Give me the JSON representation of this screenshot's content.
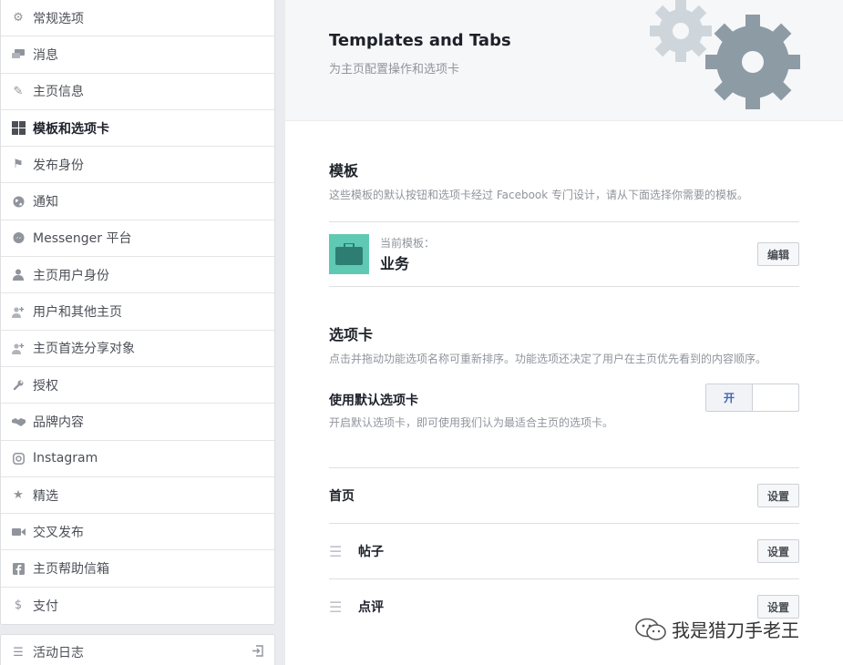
{
  "sidebar": {
    "items": [
      {
        "label": "常规选项",
        "icon": "gear-icon"
      },
      {
        "label": "消息",
        "icon": "messages-icon"
      },
      {
        "label": "主页信息",
        "icon": "pencil-icon"
      },
      {
        "label": "模板和选项卡",
        "icon": "grid-icon",
        "active": true
      },
      {
        "label": "发布身份",
        "icon": "flag-icon"
      },
      {
        "label": "通知",
        "icon": "globe-icon"
      },
      {
        "label": "Messenger 平台",
        "icon": "messenger-icon"
      },
      {
        "label": "主页用户身份",
        "icon": "person-icon"
      },
      {
        "label": "用户和其他主页",
        "icon": "person-plus-icon"
      },
      {
        "label": "主页首选分享对象",
        "icon": "person-plus-icon"
      },
      {
        "label": "授权",
        "icon": "wrench-icon"
      },
      {
        "label": "品牌内容",
        "icon": "handshake-icon"
      },
      {
        "label": "Instagram",
        "icon": "instagram-icon"
      },
      {
        "label": "精选",
        "icon": "star-icon"
      },
      {
        "label": "交叉发布",
        "icon": "video-icon"
      },
      {
        "label": "主页帮助信箱",
        "icon": "facebook-icon"
      },
      {
        "label": "支付",
        "icon": "dollar-icon"
      }
    ],
    "activity_log": "活动日志"
  },
  "header": {
    "title": "Templates and Tabs",
    "subtitle": "为主页配置操作和选项卡"
  },
  "templates": {
    "title": "模板",
    "description": "这些模板的默认按钮和选项卡经过 Facebook 专门设计，请从下面选择你需要的模板。",
    "current_label": "当前模板：",
    "current_name": "业务",
    "edit_button": "编辑"
  },
  "tabs": {
    "title": "选项卡",
    "description": "点击并拖动功能选项名称可重新排序。功能选项还决定了用户在主页优先看到的内容顺序。",
    "default_title": "使用默认选项卡",
    "default_desc": "开启默认选项卡，即可使用我们认为最适合主页的选项卡。",
    "toggle_on": "开",
    "rows": [
      {
        "label": "首页",
        "button": "设置",
        "draggable": false
      },
      {
        "label": "帖子",
        "button": "设置",
        "draggable": true
      },
      {
        "label": "点评",
        "button": "设置",
        "draggable": true
      }
    ]
  },
  "watermark": "我是猎刀手老王",
  "colors": {
    "accent": "#4267b2",
    "template_bg": "#5fc9b4",
    "gear": "#8d9ba5"
  }
}
